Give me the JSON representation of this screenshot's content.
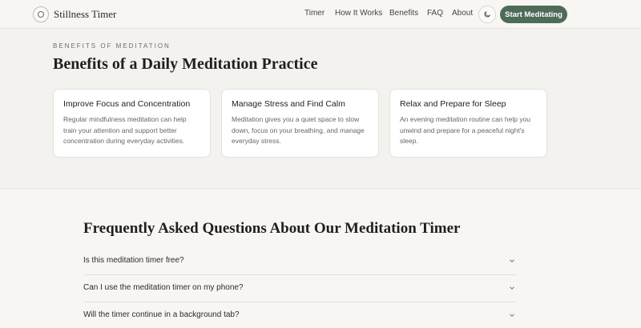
{
  "nav": {
    "brand": "Stillness Timer",
    "links": [
      "Timer",
      "How It Works",
      "Benefits",
      "FAQ",
      "About"
    ],
    "cta": "Start Meditating",
    "theme_icon": "moon-icon"
  },
  "benefits": {
    "eyebrow": "BENEFITS OF MEDITATION",
    "title": "Benefits of a Daily Meditation Practice",
    "cards": [
      {
        "title": "Improve Focus and Concentration",
        "body": "Regular mindfulness meditation can help train your attention and support better concentration during everyday activities."
      },
      {
        "title": "Manage Stress and Find Calm",
        "body": "Meditation gives you a quiet space to slow down, focus on your breathing, and manage everyday stress."
      },
      {
        "title": "Relax and Prepare for Sleep",
        "body": "An evening meditation routine can help you unwind and prepare for a peaceful night's sleep."
      }
    ]
  },
  "faq": {
    "title": "Frequently Asked Questions About Our Meditation Timer",
    "items": [
      {
        "question": "Is this meditation timer free?"
      },
      {
        "question": "Can I use the meditation timer on my phone?"
      },
      {
        "question": "Will the timer continue in a background tab?"
      }
    ]
  },
  "colors": {
    "accent": "#4e6b58",
    "background": "#f5f4f1"
  }
}
